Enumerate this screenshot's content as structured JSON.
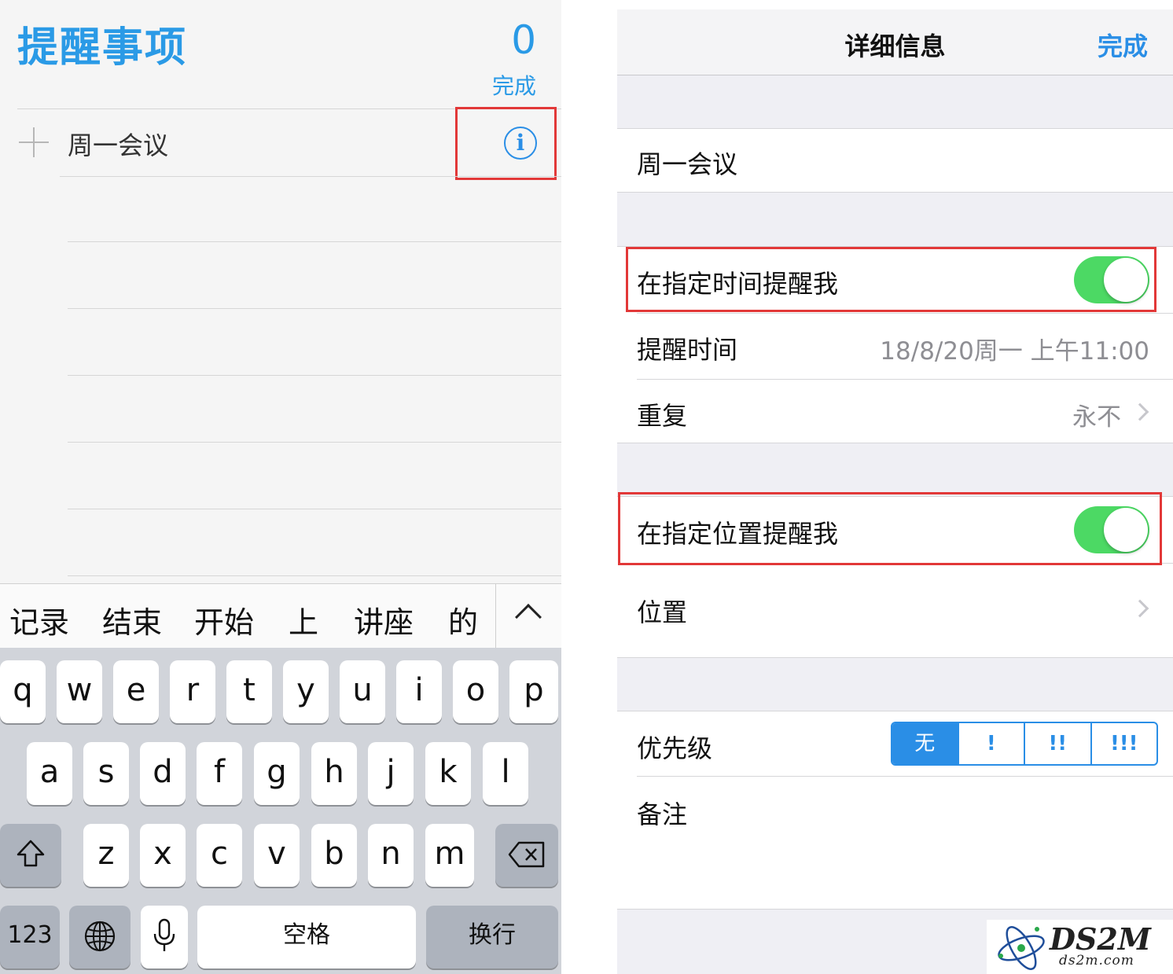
{
  "left": {
    "list_title": "提醒事项",
    "completed_count": "0",
    "completed_label": "完成",
    "reminder_text": "周一会议",
    "candidates": [
      "记录",
      "结束",
      "开始",
      "上",
      "讲座",
      "的"
    ],
    "keyboard": {
      "row1": [
        "q",
        "w",
        "e",
        "r",
        "t",
        "y",
        "u",
        "i",
        "o",
        "p"
      ],
      "row2": [
        "a",
        "s",
        "d",
        "f",
        "g",
        "h",
        "j",
        "k",
        "l"
      ],
      "row3": [
        "z",
        "x",
        "c",
        "v",
        "b",
        "n",
        "m"
      ],
      "numbers_key": "123",
      "space_key": "空格",
      "return_key": "换行"
    }
  },
  "right": {
    "nav_title": "详细信息",
    "done": "完成",
    "title": "周一会议",
    "remind_on_day": {
      "label": "在指定时间提醒我",
      "on": true
    },
    "alarm": {
      "label": "提醒时间",
      "value": "18/8/20周一 上午11:00"
    },
    "repeat": {
      "label": "重复",
      "value": "永不"
    },
    "remind_at_location": {
      "label": "在指定位置提醒我",
      "on": true
    },
    "location": {
      "label": "位置"
    },
    "priority": {
      "label": "优先级",
      "options": [
        "无",
        "!",
        "!!",
        "!!!"
      ],
      "selected": "无"
    },
    "notes": {
      "label": "备注"
    }
  },
  "watermark": {
    "logo": "DS2M",
    "domain": "ds2m.com"
  },
  "colors": {
    "accent_blue": "#2a9ae6",
    "toggle_green": "#4cd964",
    "highlight_red": "#e23838"
  }
}
